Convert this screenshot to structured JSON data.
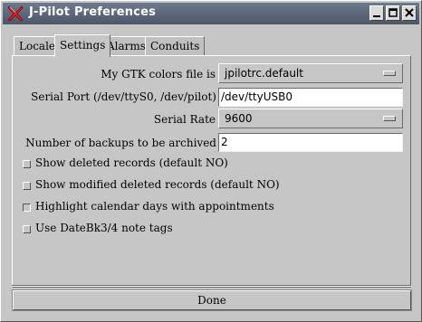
{
  "window": {
    "title": "J-Pilot Preferences",
    "icon": "jpilot-x-icon",
    "controls": [
      "minimize-icon",
      "maximize-icon",
      "close-icon"
    ]
  },
  "tabs": [
    {
      "label": "Locale",
      "active": false
    },
    {
      "label": "Settings",
      "active": true
    },
    {
      "label": "Alarms",
      "active": false
    },
    {
      "label": "Conduits",
      "active": false
    }
  ],
  "settings": {
    "gtk_colors": {
      "label": "My GTK colors file is",
      "value": "jpilotrc.default"
    },
    "serial_port": {
      "label": "Serial Port (/dev/ttyS0, /dev/pilot)",
      "value": "/dev/ttyUSB0"
    },
    "serial_rate": {
      "label": "Serial Rate",
      "value": "9600"
    },
    "backups": {
      "label": "Number of backups to be archived",
      "value": "2"
    }
  },
  "checkboxes": [
    {
      "label": "Show deleted records (default NO)",
      "checked": false
    },
    {
      "label": "Show modified deleted records (default NO)",
      "checked": false
    },
    {
      "label": "Highlight calendar days with appointments",
      "checked": true
    },
    {
      "label": "Use DateBk3/4 note tags",
      "checked": false
    }
  ],
  "buttons": {
    "done": "Done"
  },
  "colors": {
    "titlebar": "#5b6779",
    "window_bg": "#c6c6c6",
    "entry_bg": "#ffffff"
  }
}
